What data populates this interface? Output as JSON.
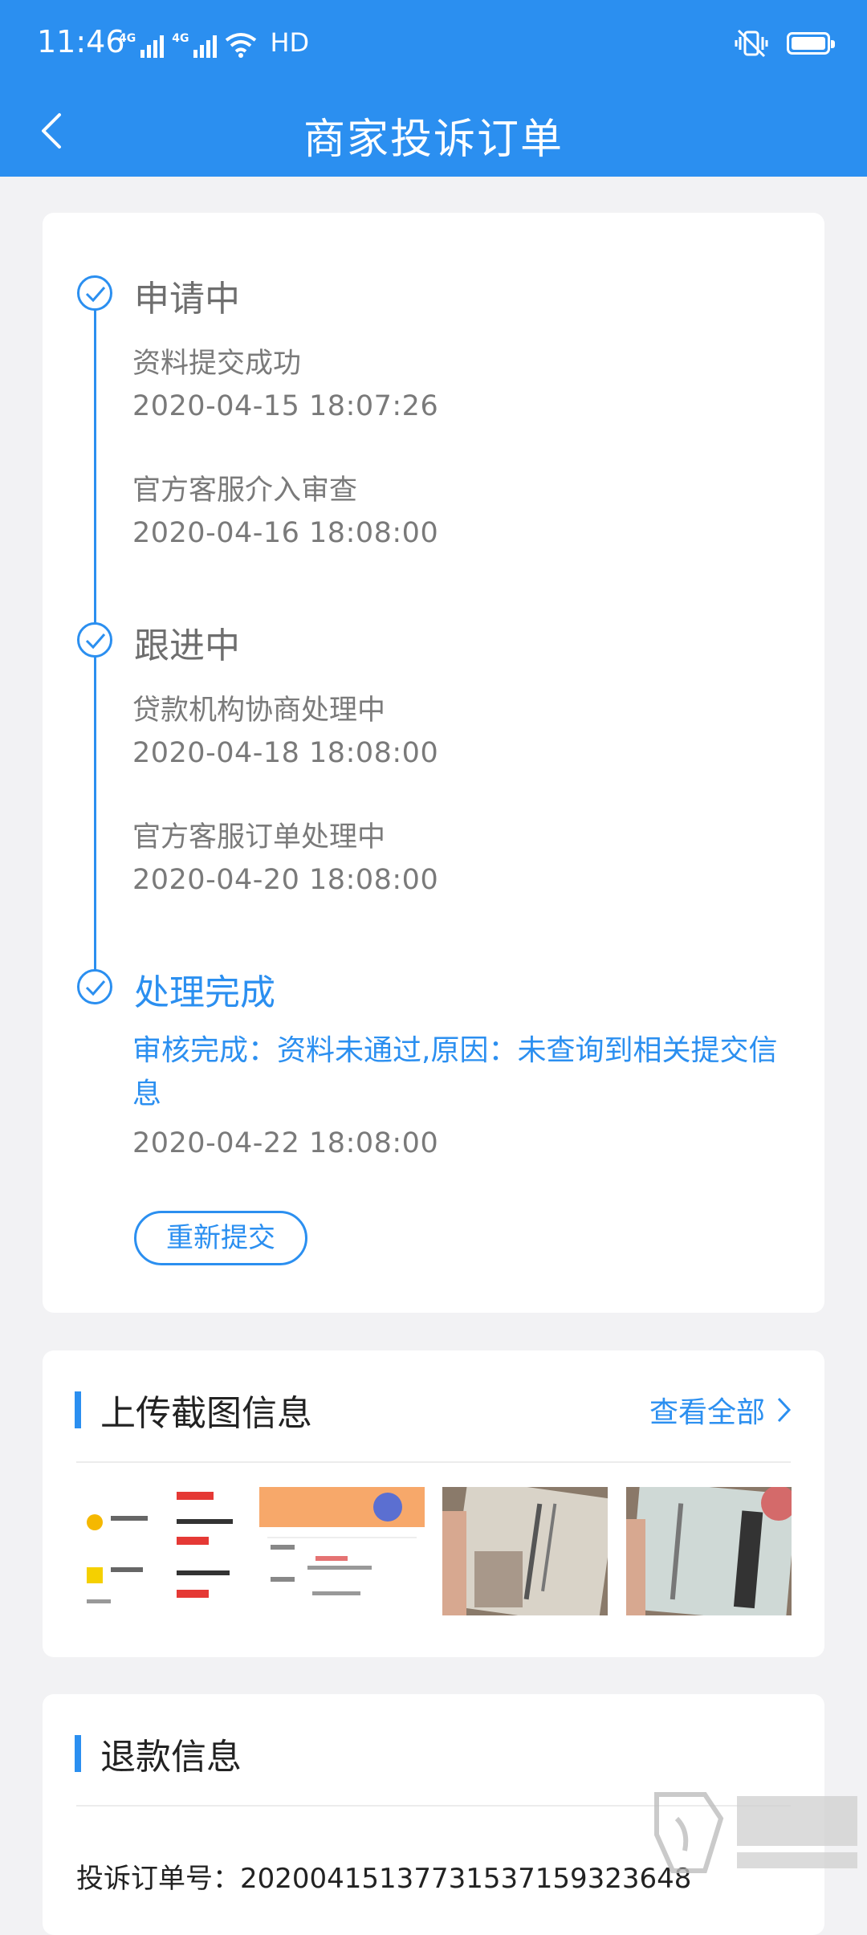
{
  "status_bar": {
    "time": "11:46",
    "signal_label_1": "4G",
    "signal_label_2": "4G",
    "hd": "HD"
  },
  "nav": {
    "title": "商家投诉订单"
  },
  "timeline": {
    "stages": [
      {
        "title": "申请中",
        "items": [
          {
            "text": "资料提交成功",
            "time": "2020-04-15 18:07:26"
          },
          {
            "text": "官方客服介入审查",
            "time": "2020-04-16 18:08:00"
          }
        ]
      },
      {
        "title": "跟进中",
        "items": [
          {
            "text": "贷款机构协商处理中",
            "time": "2020-04-18 18:08:00"
          },
          {
            "text": "官方客服订单处理中",
            "time": "2020-04-20 18:08:00"
          }
        ]
      },
      {
        "title": "处理完成",
        "result": "审核完成：资料未通过,原因：未查询到相关提交信息",
        "time": "2020-04-22 18:08:00"
      }
    ],
    "resubmit_label": "重新提交"
  },
  "screenshots": {
    "title": "上传截图信息",
    "view_all": "查看全部"
  },
  "refund": {
    "title": "退款信息",
    "order_no": "投诉订单号：20200415137731537159323648"
  },
  "colors": {
    "accent": "#2b8ff0",
    "background": "#f2f2f4"
  }
}
